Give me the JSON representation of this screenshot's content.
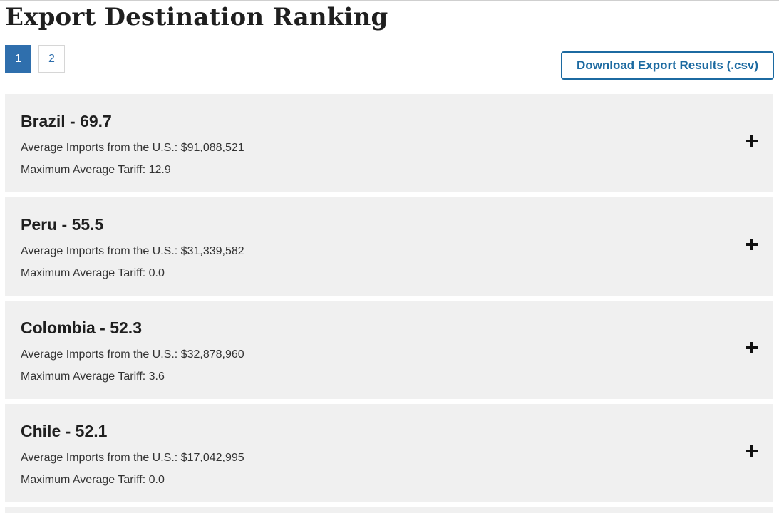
{
  "page": {
    "title": "Export Destination Ranking"
  },
  "pagination": {
    "pages": [
      "1",
      "2"
    ],
    "active": "1"
  },
  "download": {
    "label": "Download Export Results (.csv)"
  },
  "results": [
    {
      "title": "Brazil - 69.7",
      "imports_line": "Average Imports from the U.S.: $91,088,521",
      "tariff_line": "Maximum Average Tariff: 12.9"
    },
    {
      "title": "Peru - 55.5",
      "imports_line": "Average Imports from the U.S.: $31,339,582",
      "tariff_line": "Maximum Average Tariff: 0.0"
    },
    {
      "title": "Colombia - 52.3",
      "imports_line": "Average Imports from the U.S.: $32,878,960",
      "tariff_line": "Maximum Average Tariff: 3.6"
    },
    {
      "title": "Chile - 52.1",
      "imports_line": "Average Imports from the U.S.: $17,042,995",
      "tariff_line": "Maximum Average Tariff: 0.0"
    }
  ],
  "icons": {
    "expand": "plus-icon"
  },
  "colors": {
    "accent": "#2f6fad",
    "download_border": "#1c6aa1",
    "card_background": "#f0f0f0"
  }
}
